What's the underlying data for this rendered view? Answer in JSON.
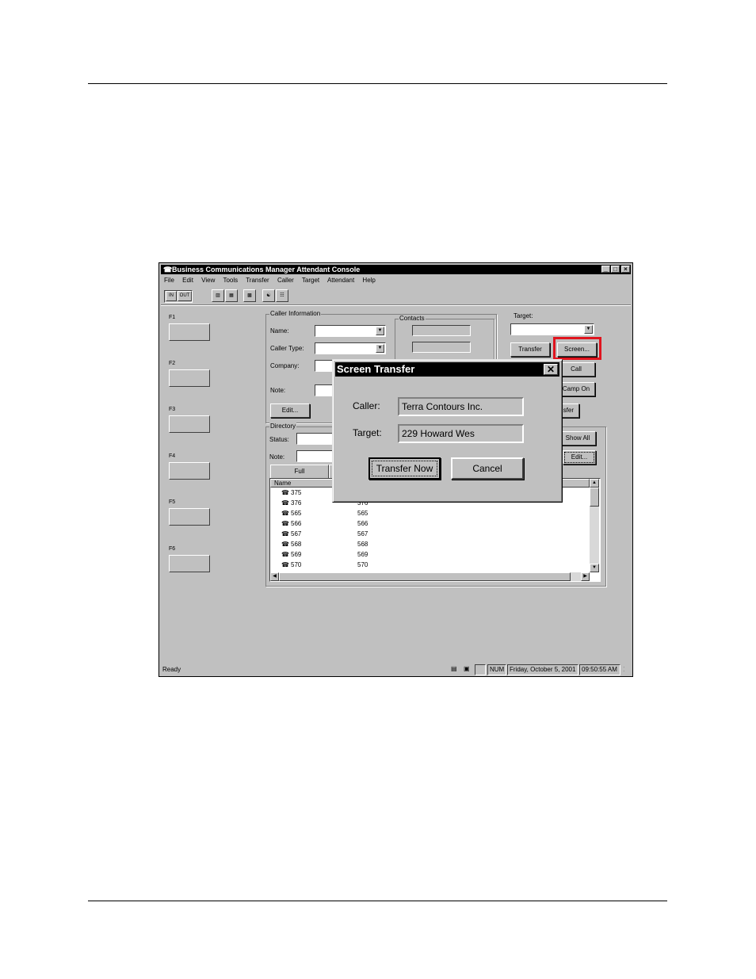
{
  "window": {
    "title": "Business Communications Manager Attendant Console",
    "menu": [
      "File",
      "Edit",
      "View",
      "Tools",
      "Transfer",
      "Caller",
      "Target",
      "Attendant",
      "Help"
    ],
    "toolbar": {
      "in_label": "IN",
      "out_label": "OUT"
    }
  },
  "fkeys": [
    "F1",
    "F2",
    "F3",
    "F4",
    "F5",
    "F6"
  ],
  "caller_info": {
    "group_label": "Caller Information",
    "name_label": "Name:",
    "caller_type_label": "Caller Type:",
    "company_label": "Company:",
    "note_label": "Note:",
    "edit_button": "Edit..."
  },
  "contacts": {
    "group_label": "Contacts"
  },
  "target": {
    "label": "Target:",
    "transfer_button": "Transfer",
    "screen_button": "Screen...",
    "call_button": "Call",
    "camp_on_button": "Camp On",
    "partial_transfer_button": "sfer"
  },
  "directory": {
    "group_label": "Directory",
    "status_label": "Status:",
    "note_label": "Note:",
    "full_tab": "Full",
    "show_all_button": "Show All",
    "edit_button": "Edit...",
    "name_header": "Name",
    "rows": [
      {
        "name": "375",
        "ext": ""
      },
      {
        "name": "376",
        "ext": "376"
      },
      {
        "name": "565",
        "ext": "565"
      },
      {
        "name": "566",
        "ext": "566"
      },
      {
        "name": "567",
        "ext": "567"
      },
      {
        "name": "568",
        "ext": "568"
      },
      {
        "name": "569",
        "ext": "569"
      },
      {
        "name": "570",
        "ext": "570"
      }
    ]
  },
  "status_bar": {
    "ready": "Ready",
    "num": "NUM",
    "date": "Friday, October 5, 2001",
    "time": "09:50:55 AM"
  },
  "dialog": {
    "title": "Screen Transfer",
    "caller_label": "Caller:",
    "caller_value": "Terra Contours Inc.",
    "target_label": "Target:",
    "target_value": "229 Howard Wes",
    "transfer_now_button": "Transfer Now",
    "cancel_button": "Cancel"
  },
  "colors": {
    "highlight": "#e0141e",
    "titlebar": "#000000",
    "face": "#c0c0c0"
  }
}
